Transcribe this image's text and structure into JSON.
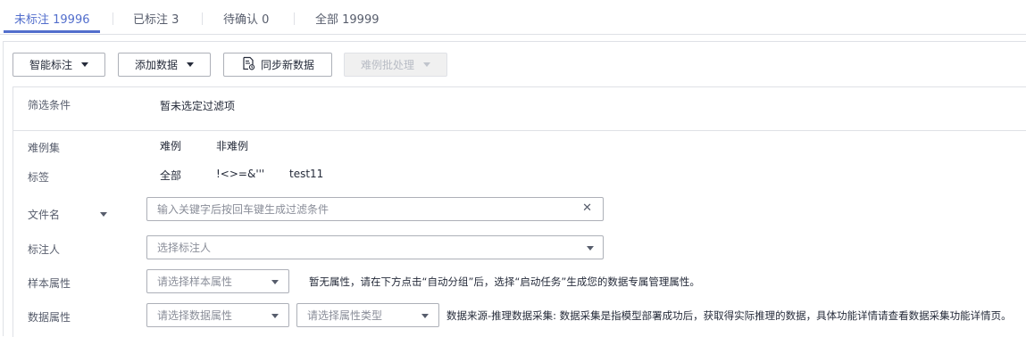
{
  "tabs": [
    {
      "label": "未标注 19996"
    },
    {
      "label": "已标注 3"
    },
    {
      "label": "待确认 0"
    },
    {
      "label": "全部 19999"
    }
  ],
  "toolbar": {
    "smart_label": "智能标注",
    "add_data": "添加数据",
    "sync_data": "同步新数据",
    "hard_batch": "难例批处理"
  },
  "filters": {
    "conditions_label": "筛选条件",
    "conditions_value": "暂未选定过滤项",
    "hard_set_label": "难例集",
    "hard_set_options": [
      "难例",
      "非难例"
    ],
    "tags_label": "标签",
    "tags_options": [
      "全部",
      "!<>=&'''",
      "test11"
    ],
    "filename_label": "文件名",
    "filename_placeholder": "输入关键字后按回车键生成过滤条件",
    "annotator_label": "标注人",
    "annotator_placeholder": "选择标注人",
    "sample_attr_label": "样本属性",
    "sample_attr_placeholder": "请选择样本属性",
    "sample_attr_hint": "暂无属性，请在下方点击“自动分组”后，选择“启动任务”生成您的数据专属管理属性。",
    "data_attr_label": "数据属性",
    "data_attr_placeholder": "请选择数据属性",
    "attr_type_placeholder": "请选择属性类型",
    "data_attr_hint": "数据来源-推理数据采集: 数据采集是指模型部署成功后，获取得实际推理的数据，具体功能详情请查看数据采集功能详情页。"
  },
  "colors": {
    "accent": "#526ecc",
    "border": "#adb0b8",
    "divider": "#dfe1e6"
  }
}
